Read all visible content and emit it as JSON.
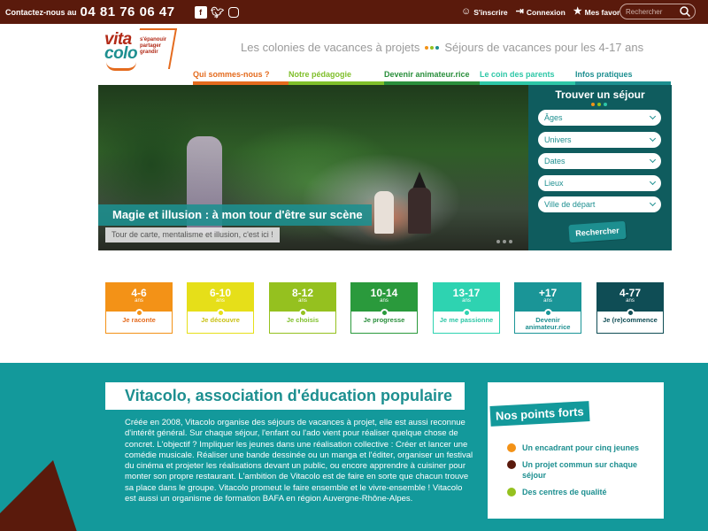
{
  "topbar": {
    "contact_label": "Contactez-nous au",
    "phone": "04 81 76 06 47",
    "social": [
      "facebook-icon",
      "twitter-icon",
      "instagram-icon"
    ],
    "user_links": [
      {
        "label": "S'inscrire",
        "icon": "user-plus-icon"
      },
      {
        "label": "Connexion",
        "icon": "login-icon"
      },
      {
        "label": "Mes favoris",
        "icon": "star-icon"
      }
    ],
    "search_placeholder": "Rechercher"
  },
  "logo": {
    "line1": "vita",
    "line2": "colo",
    "tag1": "s'épanouir",
    "tag2": "partager",
    "tag3": "grandir"
  },
  "tagline": {
    "left": "Les colonies de vacances à projets",
    "right": "Séjours de vacances pour les 4-17 ans"
  },
  "nav": [
    {
      "label": "Qui sommes-nous ?"
    },
    {
      "label": "Notre pédagogie"
    },
    {
      "label": "Devenir animateur.rice"
    },
    {
      "label": "Le coin des parents"
    },
    {
      "label": "Infos pratiques"
    }
  ],
  "hero": {
    "caption": "Magie et illusion : à mon tour d'être sur scène",
    "subcaption": "Tour de carte, mentalisme et illusion, c'est ici !"
  },
  "finder": {
    "title": "Trouver un séjour",
    "selects": [
      "Âges",
      "Univers",
      "Dates",
      "Lieux",
      "Ville de départ"
    ],
    "button": "Rechercher"
  },
  "ages": [
    {
      "range": "4-6",
      "unit": "ans",
      "label": "Je raconte",
      "color": "#f39217",
      "text": "#e46b1e"
    },
    {
      "range": "6-10",
      "unit": "ans",
      "label": "Je découvre",
      "color": "#e6df19",
      "text": "#c9c014"
    },
    {
      "range": "8-12",
      "unit": "ans",
      "label": "Je choisis",
      "color": "#95c11f",
      "text": "#7fbf2a"
    },
    {
      "range": "10-14",
      "unit": "ans",
      "label": "Je progresse",
      "color": "#2a9a3c",
      "text": "#2a8f3c"
    },
    {
      "range": "13-17",
      "unit": "ans",
      "label": "Je me passionne",
      "color": "#2ed3b1",
      "text": "#2dc7a7"
    },
    {
      "range": "+17",
      "unit": "ans",
      "label": "Devenir animateur.rice",
      "color": "#1a9597",
      "text": "#1d8f90"
    },
    {
      "range": "4-77",
      "unit": "ans",
      "label": "Je (re)commence",
      "color": "#0f4d55",
      "text": "#0f4d55"
    }
  ],
  "about": {
    "title": "Vitacolo, association d'éducation populaire",
    "paragraph": "Créée en 2008, Vitacolo organise des séjours de vacances à projet, elle est aussi reconnue d'intérêt général. Sur chaque séjour, l'enfant ou l'ado vient pour réaliser quelque chose de concret. L'objectif ? Impliquer les jeunes dans une réalisation collective : Créer et lancer une comédie musicale. Réaliser une bande dessinée ou un manga et l'éditer, organiser un festival du cinéma et projeter les réalisations devant un public, ou encore apprendre à cuisiner pour monter son propre restaurant. L'ambition de Vitacolo est de faire en sorte que chacun trouve sa place dans le groupe. Vitacolo promeut le faire ensemble et le vivre-ensemble ! Vitacolo est aussi un organisme de formation BAFA en région Auvergne-Rhône-Alpes."
  },
  "forts": {
    "title": "Nos points forts",
    "items": [
      {
        "label": "Un encadrant pour cinq jeunes",
        "color": "#f39217"
      },
      {
        "label": "Un projet commun sur chaque séjour",
        "color": "#5a1a0c"
      },
      {
        "label": "Des centres de qualité",
        "color": "#95c11f"
      }
    ]
  },
  "colors": {
    "brand_dark": "#5a1a0c",
    "teal": "#1d8f90",
    "teal_bright": "#13999b"
  }
}
